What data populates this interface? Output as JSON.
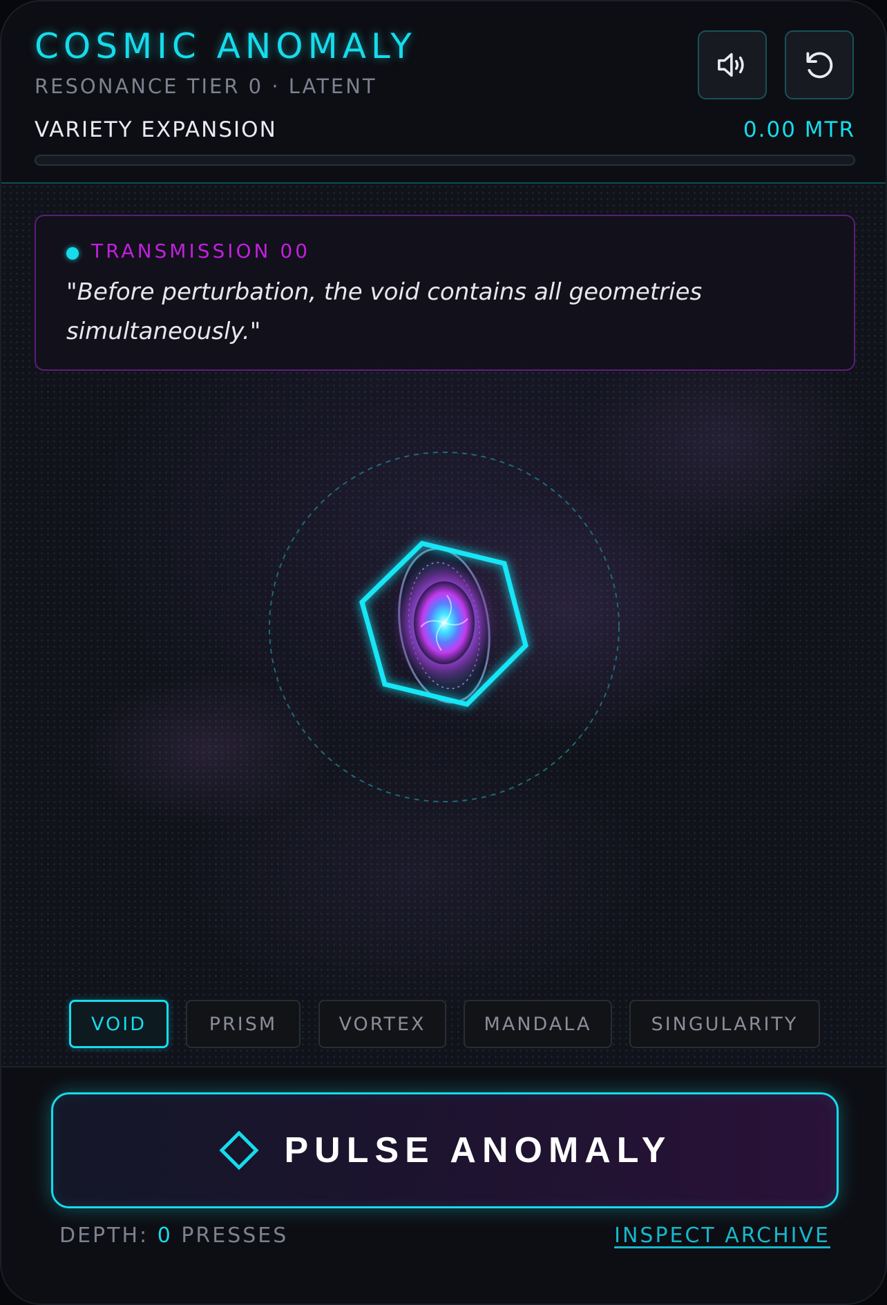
{
  "header": {
    "title": "COSMIC ANOMALY",
    "subtitle": "RESONANCE TIER 0 · LATENT",
    "sound_icon": "speaker-volume-icon",
    "reset_icon": "reset-rotate-icon",
    "expansion": {
      "label": "VARIETY EXPANSION",
      "value": "0.00 MTR",
      "progress_fraction": 0
    }
  },
  "transmission": {
    "label": "TRANSMISSION 00",
    "quote": "\"Before perturbation, the void contains all geometries simultaneously.\""
  },
  "anomaly": {
    "selected_form": "VOID",
    "core_icon": "hexagon-galaxy-icon"
  },
  "forms": {
    "items": [
      {
        "label": "VOID",
        "active": true
      },
      {
        "label": "PRISM",
        "active": false
      },
      {
        "label": "VORTEX",
        "active": false
      },
      {
        "label": "MANDALA",
        "active": false
      },
      {
        "label": "SINGULARITY",
        "active": false
      }
    ]
  },
  "footer": {
    "pulse_icon": "diamond-outline-icon",
    "pulse_label": "PULSE ANOMALY",
    "depth_prefix": "DEPTH: ",
    "depth_count": "0",
    "depth_suffix": " PRESSES",
    "archive_link": "INSPECT ARCHIVE"
  },
  "colors": {
    "accent": "#16dcec",
    "transmission_label": "#c21fe0",
    "muted_text": "#7d8290",
    "background": "#0b0c12"
  }
}
